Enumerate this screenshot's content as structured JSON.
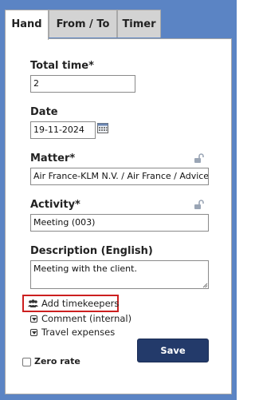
{
  "tabs": [
    {
      "label": "Hand",
      "active": true
    },
    {
      "label": "From / To",
      "active": false
    },
    {
      "label": "Timer",
      "active": false
    }
  ],
  "form": {
    "total_time_label": "Total time*",
    "total_time_value": "2",
    "date_label": "Date",
    "date_value": "19-11-2024",
    "matter_label": "Matter*",
    "matter_value": "Air France-KLM N.V. / Air France / Advice",
    "activity_label": "Activity*",
    "activity_value": "Meeting (003)",
    "description_label": "Description (English)",
    "description_value": "Meeting with the client."
  },
  "links": {
    "add_timekeepers": "Add timekeepers",
    "comment": "Comment (internal)",
    "travel_expenses": "Travel expenses"
  },
  "zero_rate_label": "Zero rate",
  "save_label": "Save",
  "colors": {
    "frame": "#5b84c4",
    "save_button": "#233a6a",
    "highlight_border": "#cc1f1f"
  },
  "icons": {
    "date_picker": "calendar-icon",
    "lock": "lock-open-icon",
    "people": "users-icon",
    "expand": "triangle-down-icon"
  }
}
